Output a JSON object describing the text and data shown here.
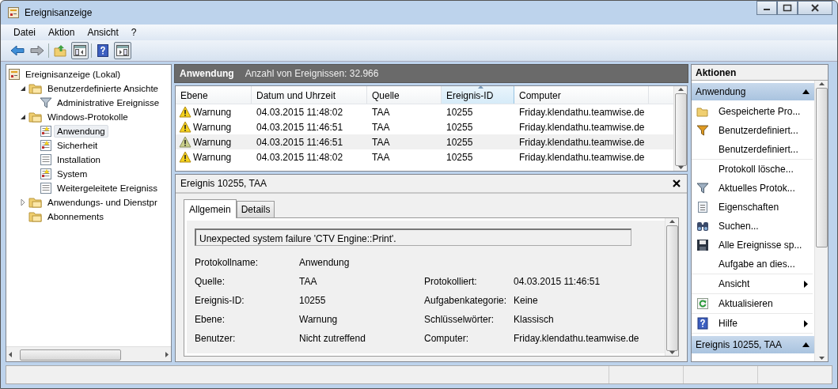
{
  "window": {
    "title": "Ereignisanzeige"
  },
  "menu": [
    {
      "label": "Datei"
    },
    {
      "label": "Aktion"
    },
    {
      "label": "Ansicht"
    },
    {
      "label": "?"
    }
  ],
  "toolbar": [
    {
      "kind": "back",
      "pressed": false
    },
    {
      "kind": "forward",
      "pressed": false
    },
    {
      "kind": "sep"
    },
    {
      "kind": "up",
      "pressed": false
    },
    {
      "kind": "tree",
      "pressed": true
    },
    {
      "kind": "sep"
    },
    {
      "kind": "help",
      "pressed": false
    },
    {
      "kind": "actions",
      "pressed": true
    }
  ],
  "tree": [
    {
      "label": "Ereignisanzeige (Lokal)",
      "kind": "root",
      "selected": false,
      "children": [
        {
          "label": "Benutzerdefinierte Ansichte",
          "kind": "folder",
          "expanded": true,
          "selected": false,
          "children": [
            {
              "label": "Administrative Ereignisse",
              "kind": "filter",
              "selected": false
            }
          ]
        },
        {
          "label": "Windows-Protokolle",
          "kind": "folder",
          "expanded": true,
          "selected": false,
          "children": [
            {
              "label": "Anwendung",
              "kind": "log",
              "selected": true
            },
            {
              "label": "Sicherheit",
              "kind": "log",
              "selected": false
            },
            {
              "label": "Installation",
              "kind": "plainlog",
              "selected": false
            },
            {
              "label": "System",
              "kind": "log",
              "selected": false
            },
            {
              "label": "Weitergeleitete Ereigniss",
              "kind": "plainlog",
              "selected": false
            }
          ]
        },
        {
          "label": "Anwendungs- und Dienstpr",
          "kind": "folder",
          "expanded": false,
          "selected": false
        },
        {
          "label": "Abonnements",
          "kind": "folder",
          "selected": false
        }
      ]
    }
  ],
  "list_header": {
    "title": "Anwendung",
    "count": "Anzahl von Ereignissen: 32.966"
  },
  "events": {
    "columns": [
      {
        "label": "Ebene",
        "sorted": false
      },
      {
        "label": "Datum und Uhrzeit",
        "sorted": false
      },
      {
        "label": "Quelle",
        "sorted": false
      },
      {
        "label": "Ereignis-ID",
        "sorted": true
      },
      {
        "label": "Computer",
        "sorted": false
      }
    ],
    "rows": [
      {
        "cells": [
          "Warnung",
          "04.03.2015 11:48:02",
          "TAA",
          "10255",
          "Friday.klendathu.teamwise.de"
        ],
        "selected": false
      },
      {
        "cells": [
          "Warnung",
          "04.03.2015 11:46:51",
          "TAA",
          "10255",
          "Friday.klendathu.teamwise.de"
        ],
        "selected": false
      },
      {
        "cells": [
          "Warnung",
          "04.03.2015 11:46:51",
          "TAA",
          "10255",
          "Friday.klendathu.teamwise.de"
        ],
        "selected": true
      },
      {
        "cells": [
          "Warnung",
          "04.03.2015 11:48:02",
          "TAA",
          "10255",
          "Friday.klendathu.teamwise.de"
        ],
        "selected": false
      }
    ]
  },
  "detail": {
    "title": "Ereignis 10255, TAA",
    "tabs": [
      {
        "label": "Allgemein",
        "selected": true
      },
      {
        "label": "Details",
        "selected": false
      }
    ],
    "message": "Unexpected system failure 'CTV Engine::Print'.",
    "rows": [
      [
        {
          "label": "Protokollname:",
          "value": "Anwendung"
        }
      ],
      [
        {
          "label": "Quelle:",
          "value": "TAA"
        },
        {
          "label": "Protokolliert:",
          "value": "04.03.2015 11:46:51"
        }
      ],
      [
        {
          "label": "Ereignis-ID:",
          "value": "10255"
        },
        {
          "label": "Aufgabenkategorie:",
          "value": "Keine"
        }
      ],
      [
        {
          "label": "Ebene:",
          "value": "Warnung"
        },
        {
          "label": "Schlüsselwörter:",
          "value": "Klassisch"
        }
      ],
      [
        {
          "label": "Benutzer:",
          "value": "Nicht zutreffend"
        },
        {
          "label": "Computer:",
          "value": "Friday.klendathu.teamwise.de"
        }
      ]
    ]
  },
  "actions": {
    "title": "Aktionen",
    "sections": [
      {
        "title": "Anwendung",
        "expanded": true,
        "groups": [
          [
            {
              "label": "Gespeicherte Pro...",
              "kind": "folder",
              "submenu": false
            },
            {
              "label": "Benutzerdefiniert...",
              "kind": "filter-new",
              "submenu": false
            },
            {
              "label": "Benutzerdefiniert...",
              "kind": "none",
              "submenu": false
            }
          ],
          [
            {
              "label": "Protokoll lösche...",
              "kind": "none",
              "submenu": false
            },
            {
              "label": "Aktuelles Protok...",
              "kind": "filter",
              "submenu": false
            },
            {
              "label": "Eigenschaften",
              "kind": "props",
              "submenu": false
            },
            {
              "label": "Suchen...",
              "kind": "binoculars",
              "submenu": false
            },
            {
              "label": "Alle Ereignisse sp...",
              "kind": "save",
              "submenu": false
            },
            {
              "label": "Aufgabe an dies...",
              "kind": "none",
              "submenu": false
            }
          ],
          [
            {
              "label": "Ansicht",
              "kind": "none",
              "submenu": true
            }
          ],
          [
            {
              "label": "Aktualisieren",
              "kind": "refresh",
              "submenu": false
            }
          ],
          [
            {
              "label": "Hilfe",
              "kind": "help",
              "submenu": true
            }
          ]
        ]
      },
      {
        "title": "Ereignis 10255, TAA",
        "expanded": true
      }
    ]
  }
}
